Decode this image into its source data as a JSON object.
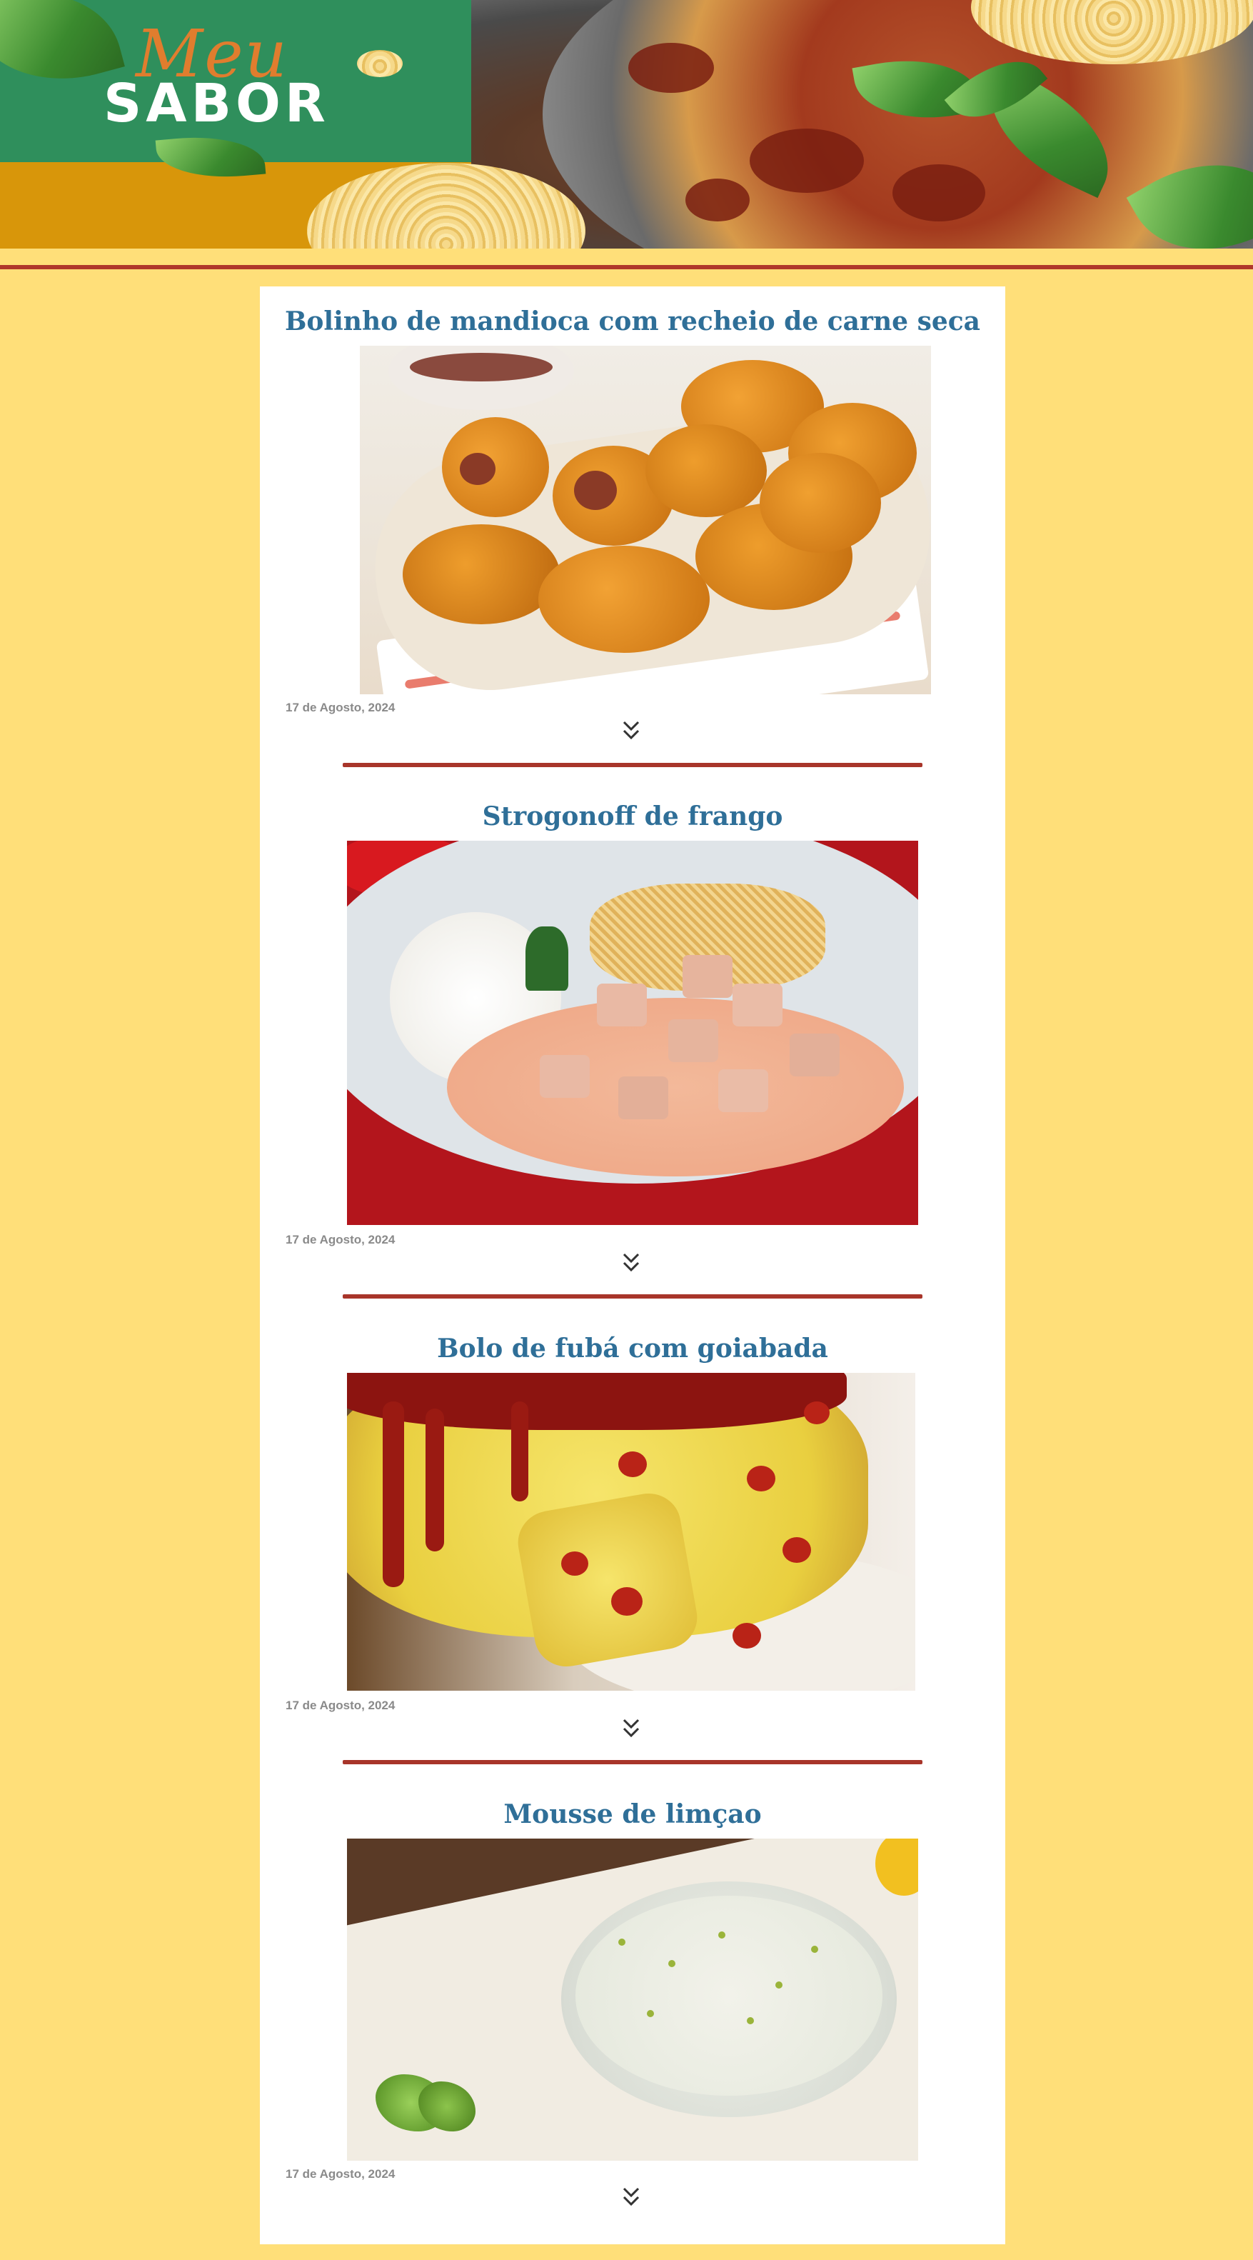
{
  "brand": {
    "word1": "Meu",
    "word2": "SABOR"
  },
  "posts": [
    {
      "title": "Bolinho de mandioca com recheio de carne seca",
      "date": "17 de Agosto, 2024",
      "image": "cassava-croquettes-photo"
    },
    {
      "title": "Strogonoff de frango",
      "date": "17 de Agosto, 2024",
      "image": "chicken-stroganoff-photo"
    },
    {
      "title": "Bolo de fubá com goiabada",
      "date": "17 de Agosto, 2024",
      "image": "cornmeal-guava-cake-photo"
    },
    {
      "title": "Mousse de limçao",
      "date": "17 de Agosto, 2024",
      "image": "lime-mousse-photo"
    }
  ],
  "icons": {
    "expand": "double-chevron-down-icon"
  },
  "colors": {
    "page_bg": "#ffdf79",
    "title": "#2f6f98",
    "separator": "#a8352a",
    "banner_green": "#2f8f5c",
    "banner_gold": "#d8960a"
  }
}
